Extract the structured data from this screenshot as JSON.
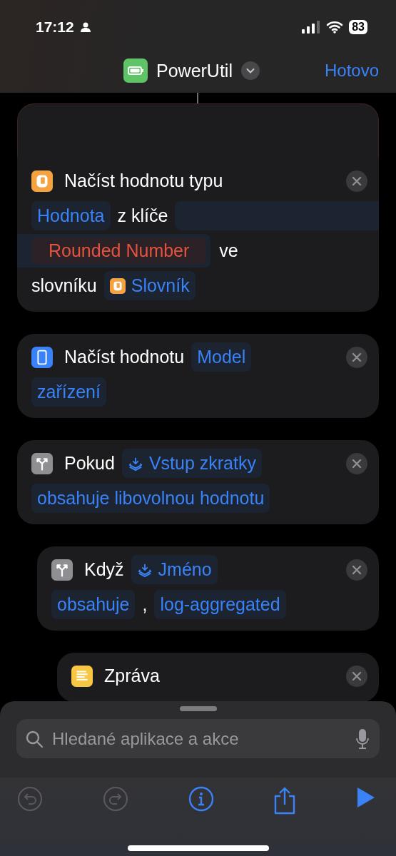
{
  "status_bar": {
    "time": "17:12",
    "battery": "83"
  },
  "nav": {
    "title": "PowerUtil",
    "done": "Hotovo"
  },
  "actions": [
    {
      "kind": "dictionary",
      "lines": [
        [
          {
            "kind": "word",
            "text": "Načíst hodnotu typu"
          }
        ],
        [
          {
            "kind": "token",
            "text": "Hodnota"
          },
          {
            "kind": "word",
            "text": "z klíče"
          },
          {
            "kind": "blank"
          }
        ],
        [
          {
            "kind": "key",
            "text": "Rounded Number"
          },
          {
            "kind": "word",
            "text": "ve"
          }
        ],
        [
          {
            "kind": "word",
            "text": "slovníku"
          },
          {
            "kind": "dictionary_variable",
            "text": "Slovník"
          }
        ]
      ]
    },
    {
      "kind": "device",
      "lines": [
        [
          {
            "kind": "word",
            "text": "Načíst hodnotu"
          },
          {
            "kind": "token",
            "text": "Model"
          }
        ],
        [
          {
            "kind": "token",
            "text": "zařízení"
          }
        ]
      ]
    },
    {
      "kind": "condition",
      "lines": [
        [
          {
            "kind": "word",
            "text": "Pokud"
          },
          {
            "kind": "variable",
            "text": "Vstup zkratky"
          }
        ],
        [
          {
            "kind": "token",
            "text": "obsahuje libovolnou hodnotu"
          }
        ]
      ],
      "children": [
        {
          "kind": "condition",
          "lines": [
            [
              {
                "kind": "word",
                "text": "Když"
              },
              {
                "kind": "variable",
                "text": "Jméno"
              }
            ],
            [
              {
                "kind": "token",
                "text": "obsahuje"
              },
              {
                "kind": "word",
                "text": ","
              },
              {
                "kind": "token",
                "text": "log-aggregated"
              }
            ]
          ],
          "children": [
            {
              "kind": "text",
              "lines": [
                [
                  {
                    "kind": "word",
                    "text": "Zpráva"
                  }
                ]
              ]
            }
          ]
        }
      ]
    }
  ],
  "search": {
    "placeholder": "Hledané aplikace a akce"
  },
  "toolbar": [
    {
      "kind": "undo",
      "disabled": true
    },
    {
      "kind": "redo",
      "disabled": true
    },
    {
      "kind": "info",
      "disabled": false
    },
    {
      "kind": "share",
      "disabled": false
    },
    {
      "kind": "run",
      "disabled": false
    }
  ]
}
